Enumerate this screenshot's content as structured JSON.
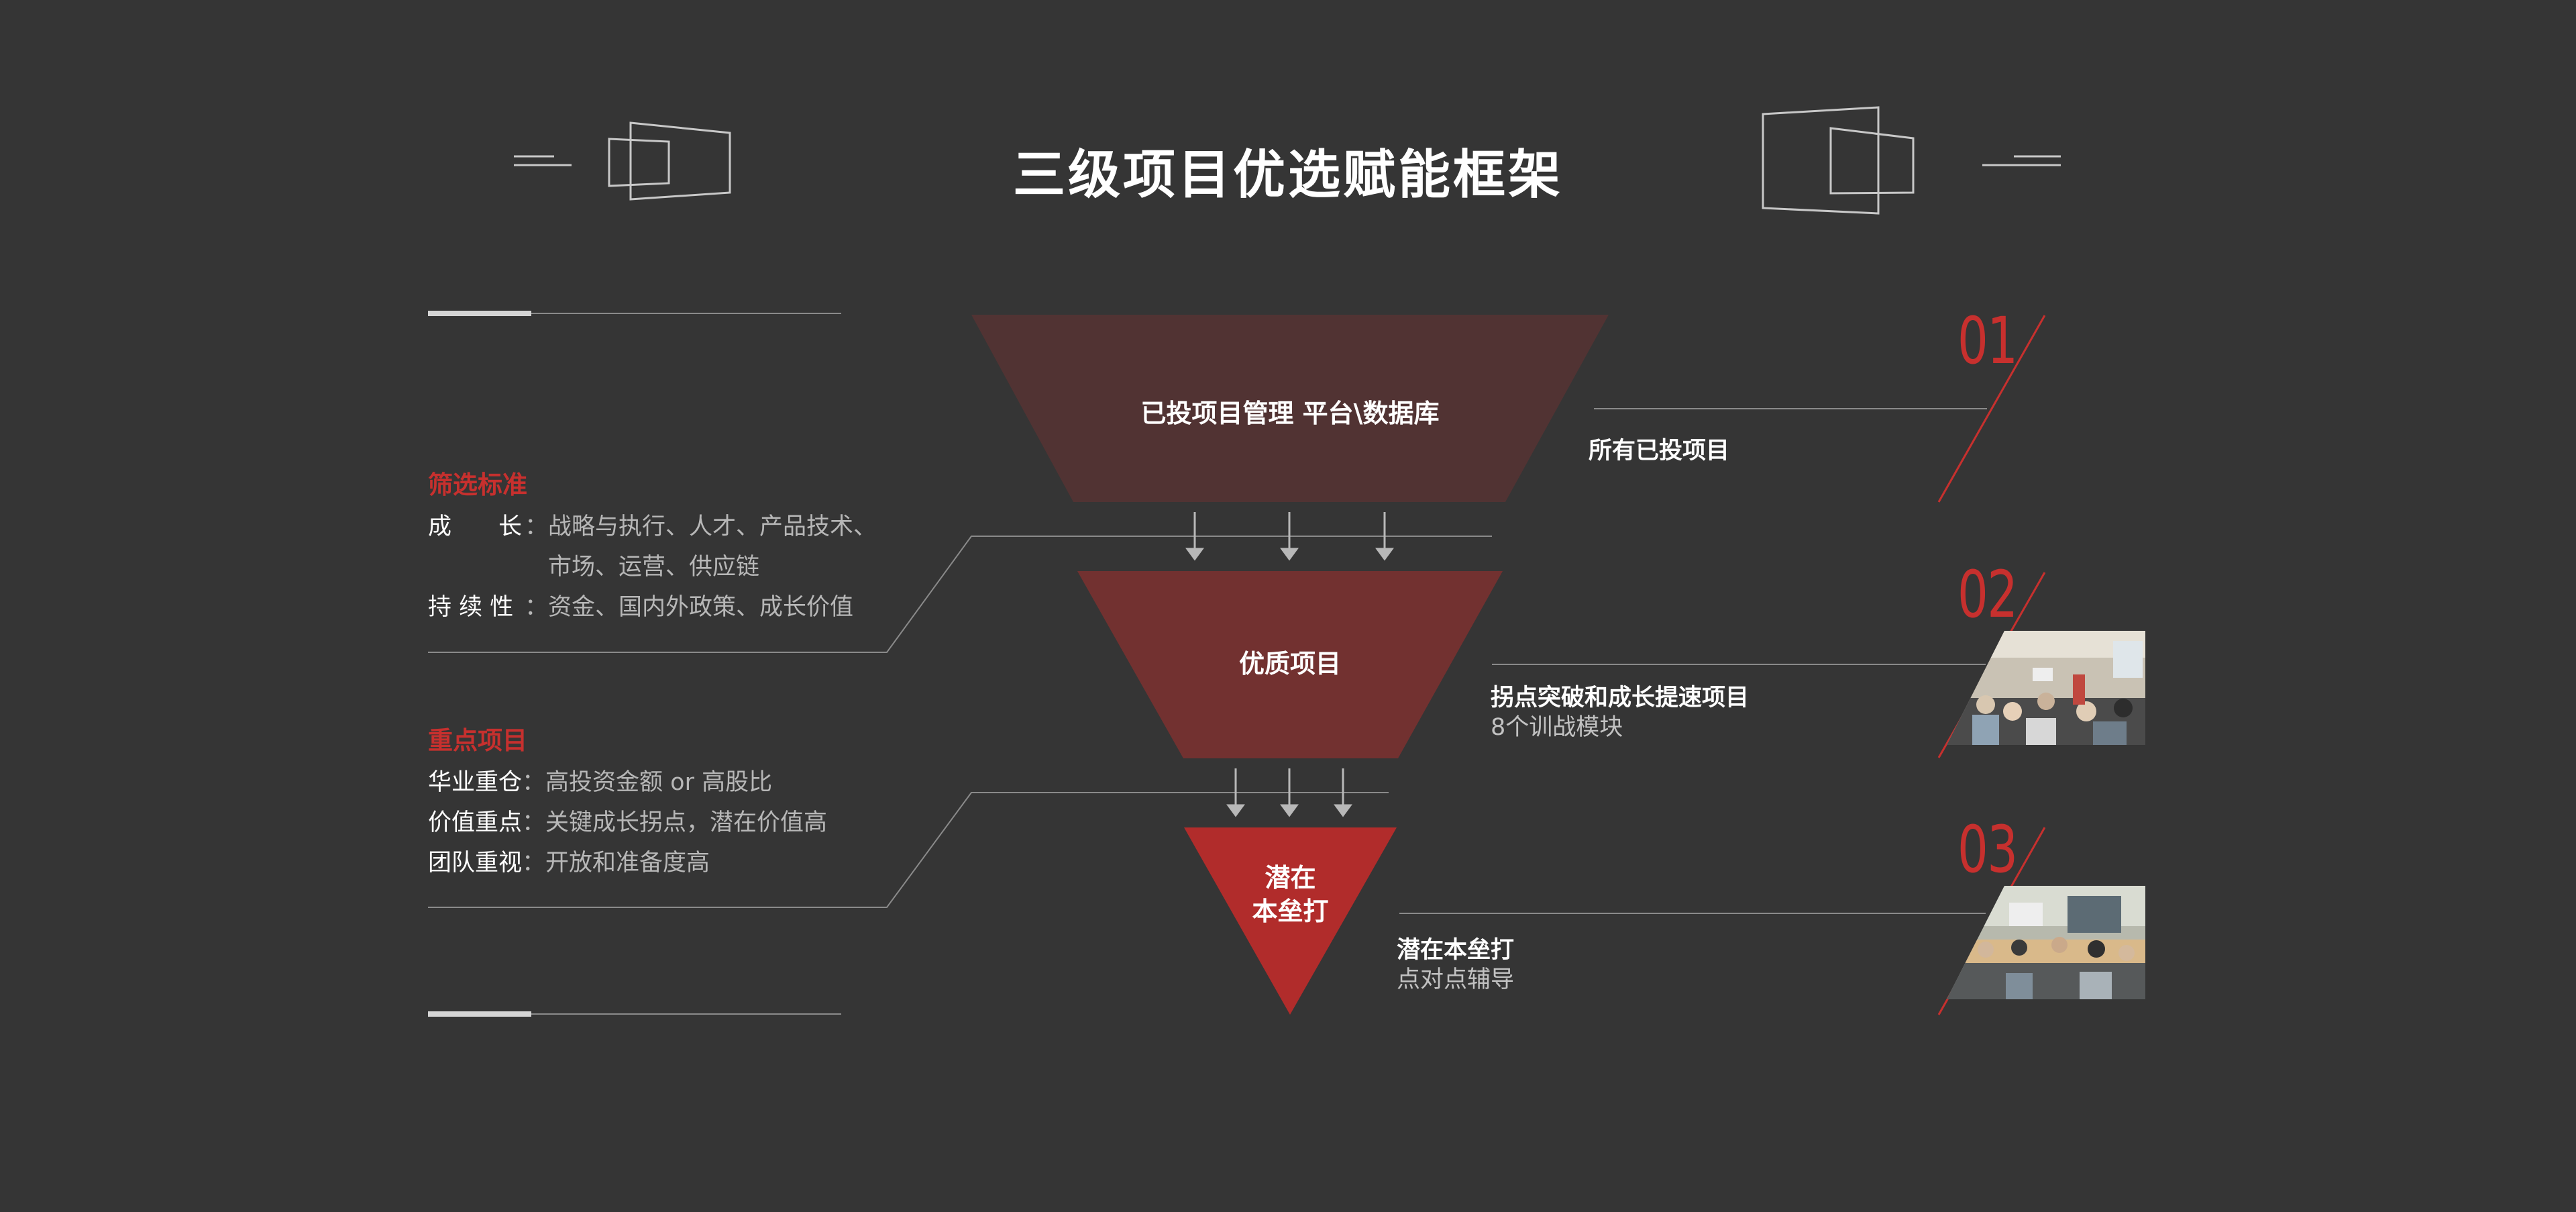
{
  "title": "三级项目优选赋能框架",
  "colors": {
    "background": "#353535",
    "accent": "#c7302e",
    "tier1": "#513333",
    "tier2": "#723130",
    "tier3": "#b12c2b",
    "line": "#8a8a8a"
  },
  "criteria": {
    "heading": "筛选标准",
    "rows": [
      {
        "key": "成　　长",
        "colon": "：",
        "value": "战略与执行、人才、产品技术、"
      },
      {
        "key": "",
        "colon": "",
        "value": "市场、运营、供应链"
      },
      {
        "key": "持 续 性",
        "colon": "：",
        "value": "资金、国内外政策、成长价值"
      }
    ]
  },
  "key_projects": {
    "heading": "重点项目",
    "rows": [
      {
        "key": "华业重仓",
        "colon": "：",
        "value": "高投资金额 or 高股比"
      },
      {
        "key": "价值重点",
        "colon": "：",
        "value": "关键成长拐点，潜在价值高"
      },
      {
        "key": "团队重视",
        "colon": "：",
        "value": "开放和准备度高"
      }
    ]
  },
  "funnel": {
    "tier1": "已投项目管理 平台\\数据库",
    "tier2": "优质项目",
    "tier3_line1": "潜在",
    "tier3_line2": "本垒打"
  },
  "levels": [
    {
      "number": "01",
      "title": "所有已投项目",
      "subtitle": ""
    },
    {
      "number": "02",
      "title": "拐点突破和成长提速项目",
      "subtitle": "8个训战模块"
    },
    {
      "number": "03",
      "title": "潜在本垒打",
      "subtitle": "点对点辅导"
    }
  ],
  "icons": [
    "frame-outline-icon",
    "down-arrow-icon",
    "classroom-photo"
  ]
}
